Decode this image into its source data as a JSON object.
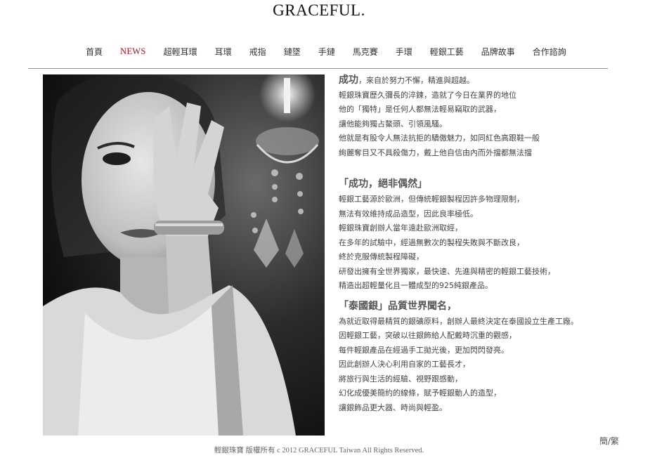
{
  "site": {
    "logo": "GRACEFUL."
  },
  "nav": [
    "首頁",
    "NEWS",
    "超輕耳環",
    "耳環",
    "戒指",
    "鏈墜",
    "手鏈",
    "馬克賽",
    "手環",
    "輕銀工藝",
    "品牌故事",
    "合作諮詢"
  ],
  "nav_active": "NEWS",
  "colors": {
    "active_nav": "#b3121a",
    "rule": "#8c8c8c",
    "text": "#444444"
  },
  "photo": {
    "icon": "model-portrait-image"
  },
  "content": {
    "p1_lead": "成功",
    "p1_rest": "，來自於努力不懈，精進與超越。",
    "p1_lines": [
      "輕銀珠寶歷久彌長的淬鍊，造就了今日在業界的地位",
      "他的「獨特」是任何人都無法輕易竊取的武器，",
      "讓他能夠獨占鰲頭、引領風騷。",
      "他就是有股令人無法抗拒的驕傲魅力，如同紅色高跟鞋一般",
      "絢麗奪目又不具殺傷力，戴上他自信由內而外擋都無法擋"
    ],
    "h2": "「成功，絕非偶然」",
    "p2_lines": [
      "輕銀工藝源於歐洲，但傳統輕銀製程因許多物理限制，",
      "無法有效維持成品造型，因此良率極低。",
      "輕銀珠寶創辦人當年遠赴歐洲取經，",
      "在多年的試驗中，經過無數次的製程失敗與不斷改良，",
      "終於克服傳統製程障礙，",
      "研發出擁有全世界獨家，最快速、先進與精密的輕銀工藝技術，",
      "精造出超輕量化且一體成型的925純銀產品。"
    ],
    "h3": "「泰國銀」品質世界聞名，",
    "p3_lines": [
      "為就近取得最精質的銀礦原料，創辦人最終決定在泰國設立生產工廠。",
      "因輕銀工藝，突破以往銀飾給人配戴時沉重的觀感，",
      "每件輕銀產品在經過手工拋光後，更加閃閃發亮。",
      "因此創辦人決心利用自家的工藝長才，",
      "將旅行與生活的經驗、視野跟感動，",
      "幻化成優美簡約的線條，賦予輕銀動人的造型，",
      "讓銀飾品更大器、時尚與輕盈。"
    ]
  },
  "footer": {
    "copyright": "輕銀珠寶 版權所有 c 2012 GRACEFUL Taiwan All Rights Reserved."
  },
  "lang_switch": "簡/繁"
}
